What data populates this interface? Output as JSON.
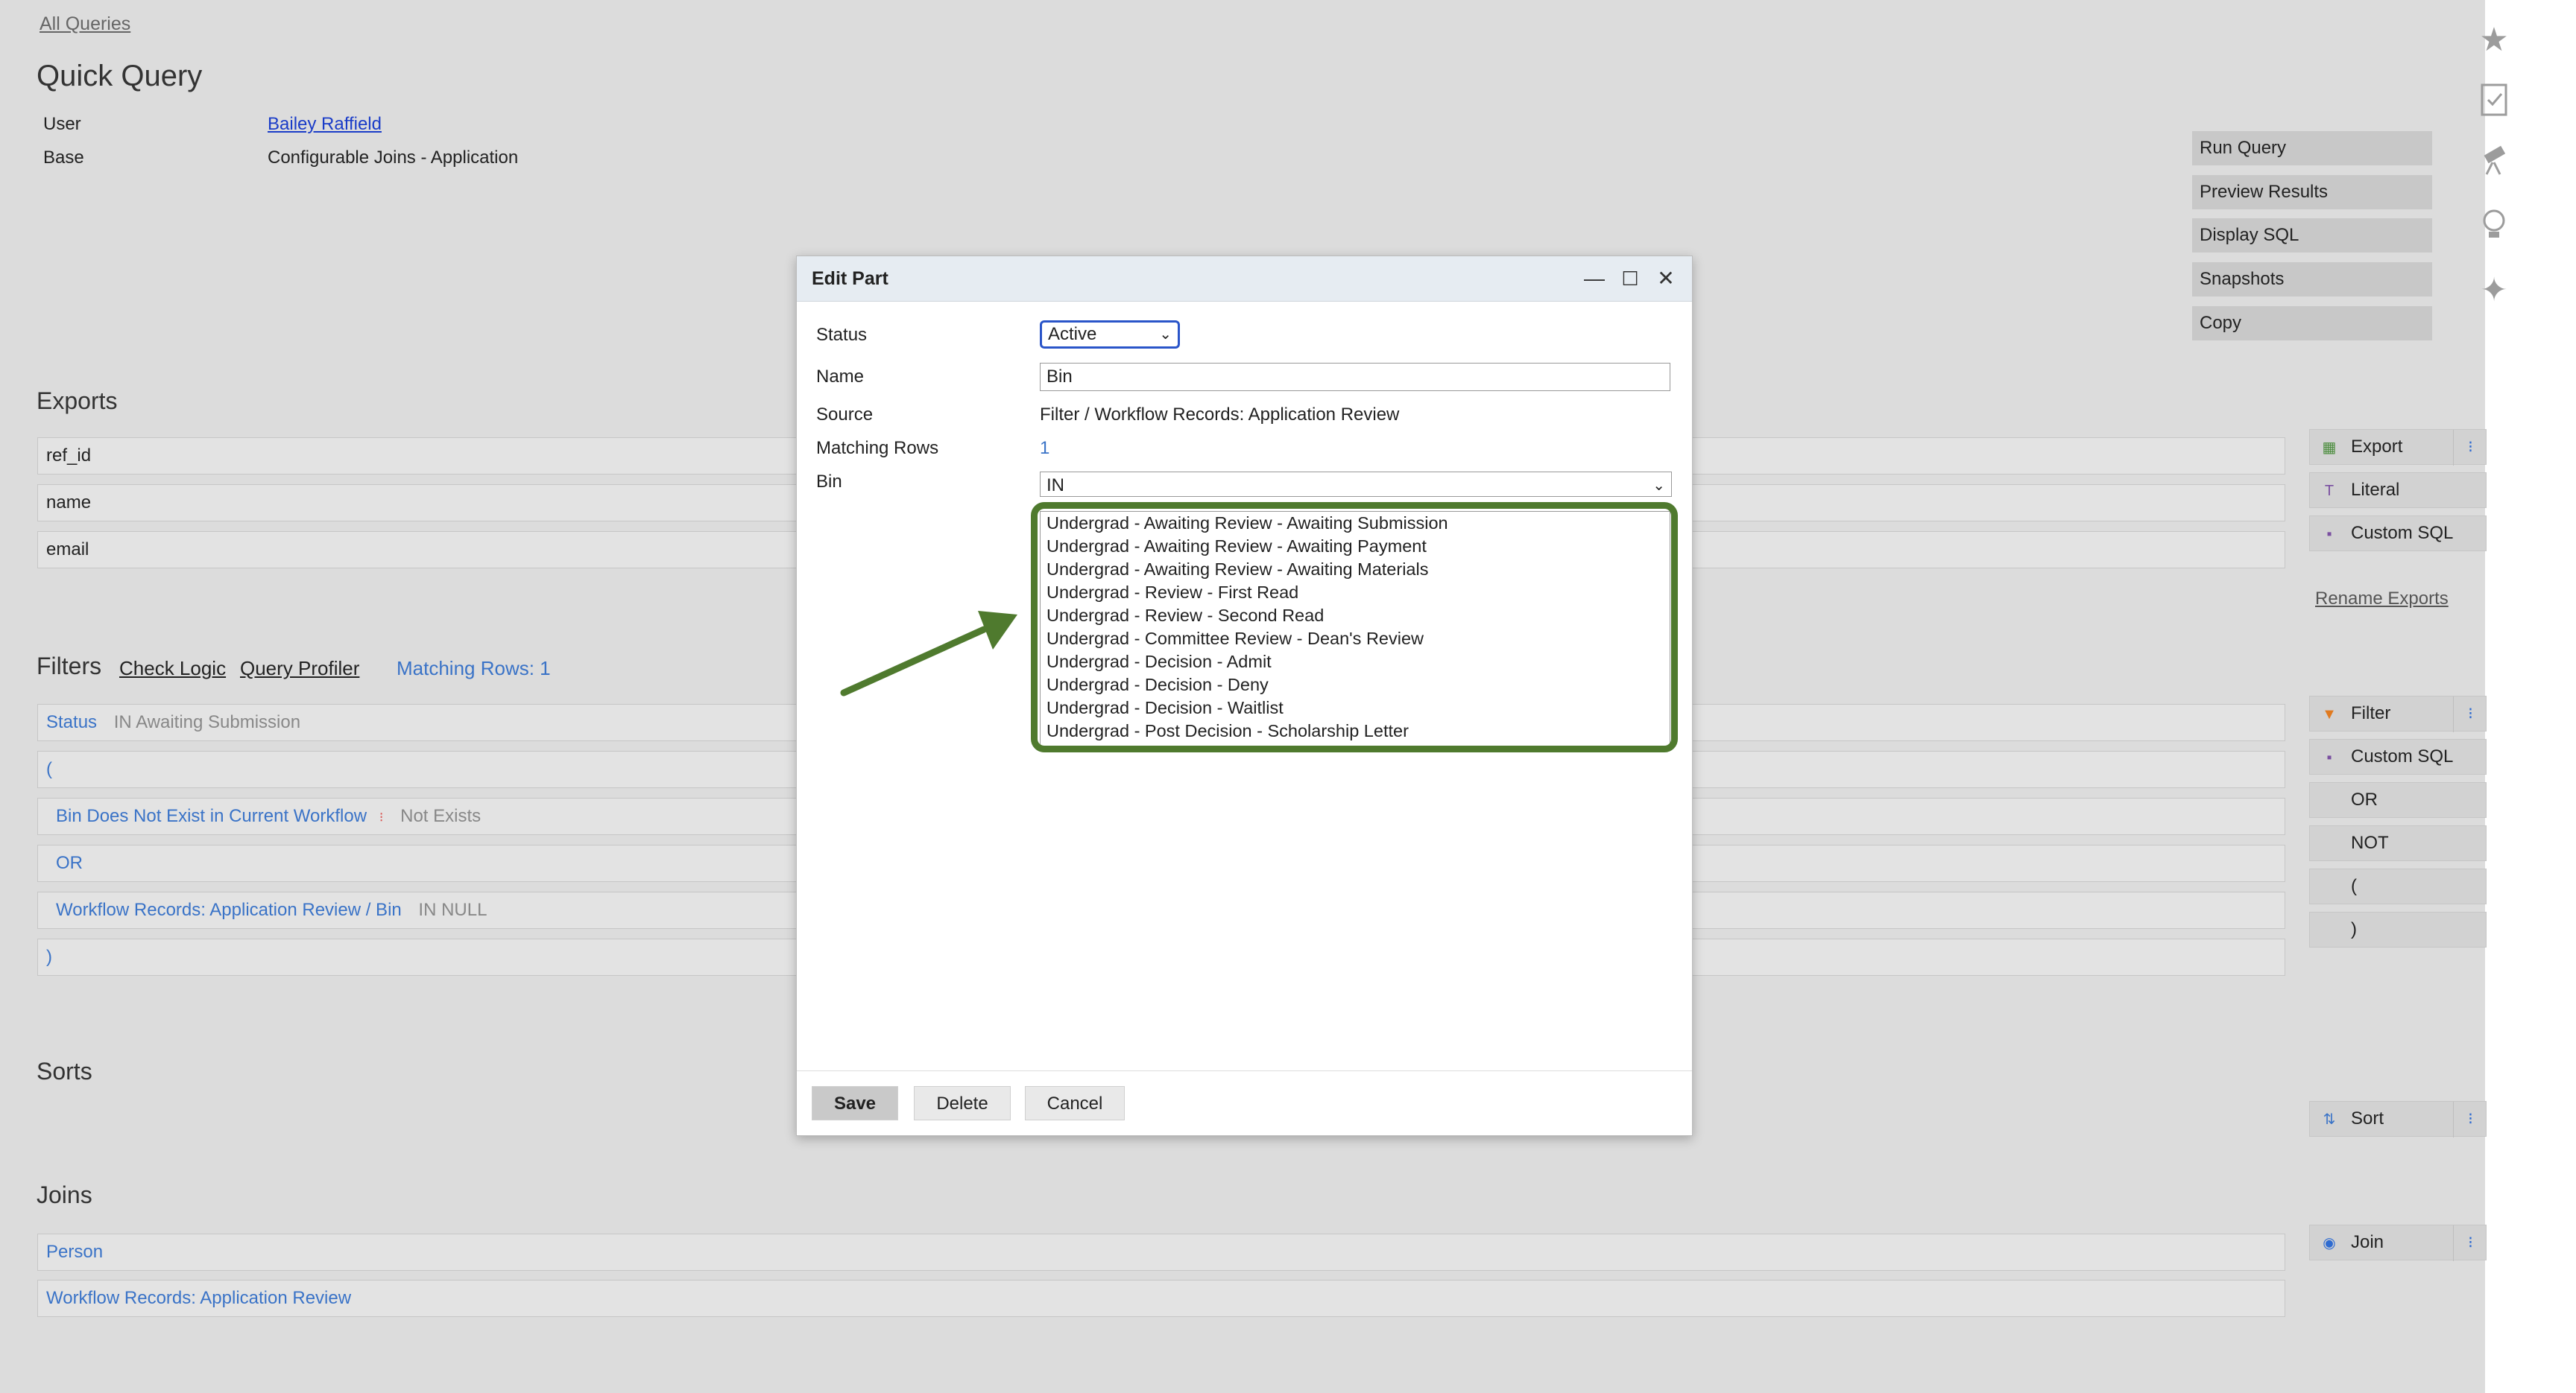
{
  "breadcrumb": "All Queries",
  "page_title": "Quick Query",
  "meta": {
    "user_label": "User",
    "user_value": "Bailey Raffield",
    "base_label": "Base",
    "base_value": "Configurable Joins - Application"
  },
  "actions": [
    "Run Query",
    "Preview Results",
    "Display SQL",
    "Snapshots",
    "Copy"
  ],
  "exports": {
    "heading": "Exports",
    "rows": [
      "ref_id",
      "name",
      "email"
    ],
    "buttons": {
      "export": "Export",
      "literal": "Literal",
      "custom_sql": "Custom SQL"
    },
    "rename": "Rename Exports"
  },
  "filters": {
    "heading": "Filters",
    "check_logic": "Check Logic",
    "query_profiler": "Query Profiler",
    "matching_rows": "Matching Rows: 1",
    "rows": [
      {
        "name": "Status",
        "detail": "IN Awaiting Submission"
      },
      {
        "name": "(",
        "detail": ""
      },
      {
        "name": "Bin Does Not Exist in Current Workflow",
        "detail": "Not Exists"
      },
      {
        "name": "OR",
        "detail": ""
      },
      {
        "name": "Workflow Records: Application Review / Bin",
        "detail": "IN NULL"
      },
      {
        "name": ")",
        "detail": ""
      }
    ],
    "buttons": {
      "filter": "Filter",
      "custom_sql": "Custom SQL",
      "or": "OR",
      "not": "NOT",
      "open_paren": "(",
      "close_paren": ")"
    }
  },
  "sorts": {
    "heading": "Sorts",
    "button": "Sort"
  },
  "joins": {
    "heading": "Joins",
    "rows": [
      "Person",
      "Workflow Records: Application Review"
    ],
    "button": "Join"
  },
  "dialog": {
    "title": "Edit Part",
    "status_label": "Status",
    "status_value": "Active",
    "name_label": "Name",
    "name_value": "Bin",
    "source_label": "Source",
    "source_value": "Filter / Workflow Records: Application Review",
    "matching_label": "Matching Rows",
    "matching_value": "1",
    "bin_label": "Bin",
    "bin_operator": "IN",
    "bin_options": [
      "Undergrad - Awaiting Review - Awaiting Submission",
      "Undergrad - Awaiting Review - Awaiting Payment",
      "Undergrad - Awaiting Review - Awaiting Materials",
      "Undergrad - Review - First Read",
      "Undergrad - Review - Second Read",
      "Undergrad - Committee Review - Dean's Review",
      "Undergrad - Decision - Admit",
      "Undergrad - Decision - Deny",
      "Undergrad - Decision - Waitlist",
      "Undergrad - Post Decision - Scholarship Letter"
    ],
    "save": "Save",
    "delete": "Delete",
    "cancel": "Cancel"
  },
  "colors": {
    "annotation": "#4f7a2e",
    "link": "#3a73c7"
  }
}
